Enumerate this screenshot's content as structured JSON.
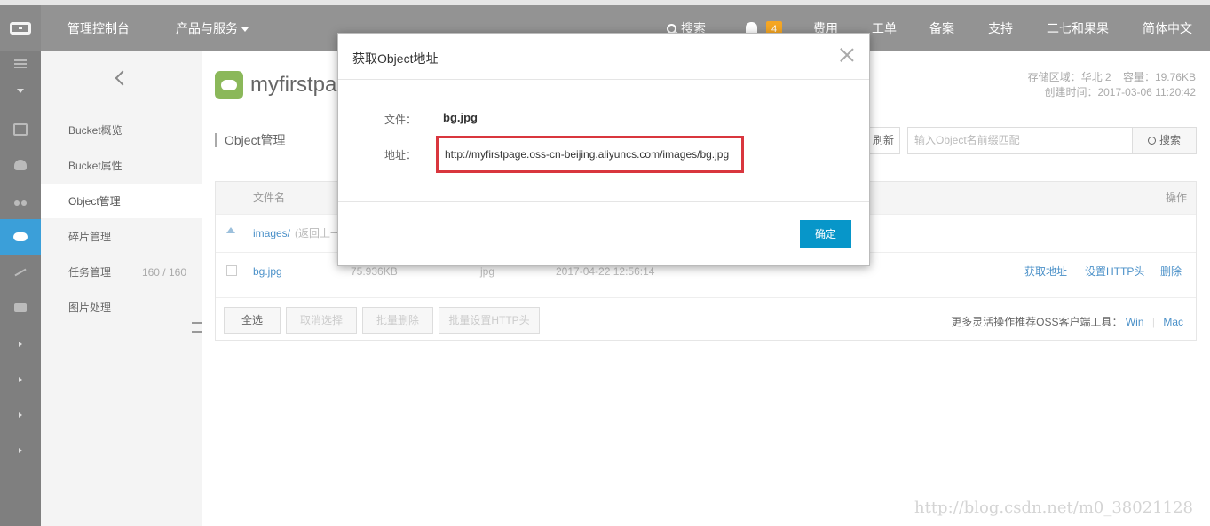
{
  "topbar": {
    "console": "管理控制台",
    "products": "产品与服务",
    "search": "搜索",
    "notif_count": "4",
    "nav": [
      "费用",
      "工单",
      "备案",
      "支持",
      "二七和果果",
      "简体中文"
    ]
  },
  "sidebar": {
    "items": [
      {
        "label": "Bucket概览"
      },
      {
        "label": "Bucket属性"
      },
      {
        "label": "Object管理"
      },
      {
        "label": "碎片管理"
      },
      {
        "label": "任务管理",
        "count": "160 / 160"
      },
      {
        "label": "图片处理"
      }
    ]
  },
  "bucket": {
    "name": "myfirstpage",
    "region": "存储区域：华北 2",
    "capacity": "容量：19.76KB",
    "created": "创建时间：2017-03-06 11:20:42"
  },
  "main": {
    "section_title": "Object管理",
    "refresh": "刷新",
    "search_placeholder": "输入Object名前缀匹配",
    "search_button": "搜索"
  },
  "table": {
    "headers": {
      "name": "文件名",
      "ops": "操作"
    },
    "parent_row": {
      "name": "images/",
      "note": "(返回上一"
    },
    "rows": [
      {
        "name": "bg.jpg",
        "size": "75.936KB",
        "type": "jpg",
        "time": "2017-04-22 12:56:14",
        "actions": [
          "获取地址",
          "设置HTTP头",
          "删除"
        ]
      }
    ],
    "buttons": [
      "全选",
      "取消选择",
      "批量删除",
      "批量设置HTTP头"
    ],
    "tools_label": "更多灵活操作推荐OSS客户端工具：",
    "tools": [
      "Win",
      "Mac"
    ]
  },
  "dialog": {
    "title": "获取Object地址",
    "file_label": "文件：",
    "file_value": "bg.jpg",
    "url_label": "地址：",
    "url_value": "http://myfirstpage.oss-cn-beijing.aliyuncs.com/images/bg.jpg",
    "ok": "确定"
  },
  "watermark": "http://blog.csdn.net/m0_38021128",
  "colors": {
    "accent": "#0796c9",
    "highlight": "#d9363e",
    "rail_active": "#3b9fd9",
    "bucket_icon": "#8bb85a"
  }
}
